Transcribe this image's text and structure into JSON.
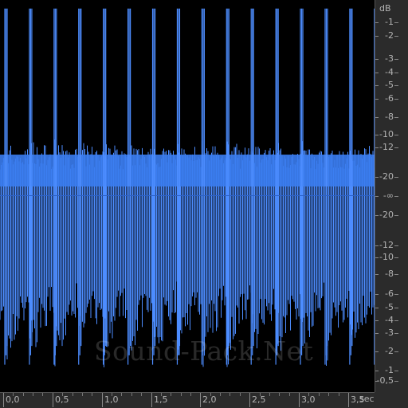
{
  "colors": {
    "waveform": "#4d8dff",
    "waveform_core": "#3a7cf0",
    "background": "#000000",
    "ruler_bg": "#2b2b2b",
    "ruler_text": "#b4b4b4"
  },
  "watermark": "Sound-Pack.Net",
  "db_ruler": {
    "unit": "dB",
    "upper_labels": [
      "-1",
      "-2",
      "-3",
      "-4",
      "-5",
      "-6",
      "-8",
      "-10",
      "-12",
      "-20"
    ],
    "center_label": "-∞",
    "lower_labels": [
      "-20",
      "-12",
      "-10",
      "-8",
      "-6",
      "-5",
      "-4",
      "-3",
      "-2",
      "-1",
      "-0,5"
    ]
  },
  "time_ruler": {
    "unit": "sec",
    "labels": [
      "0,0",
      "0,5",
      "1,0",
      "1,5",
      "2,0",
      "2,5",
      "3,0",
      "3,5"
    ]
  },
  "chart_data": {
    "type": "area",
    "title": "",
    "xlabel": "sec",
    "ylabel": "dB",
    "xlim": [
      0.0,
      3.8
    ],
    "ylim": [
      -1.0,
      1.0
    ],
    "beat_interval_sec": 0.25,
    "beat_count": 16,
    "series": [
      {
        "values": [
          0.98,
          0.98,
          0.98,
          0.98,
          0.98,
          0.98,
          0.98,
          0.98,
          0.98,
          0.98,
          0.98,
          0.98,
          0.98,
          0.98,
          0.98,
          0.98
        ]
      }
    ]
  }
}
